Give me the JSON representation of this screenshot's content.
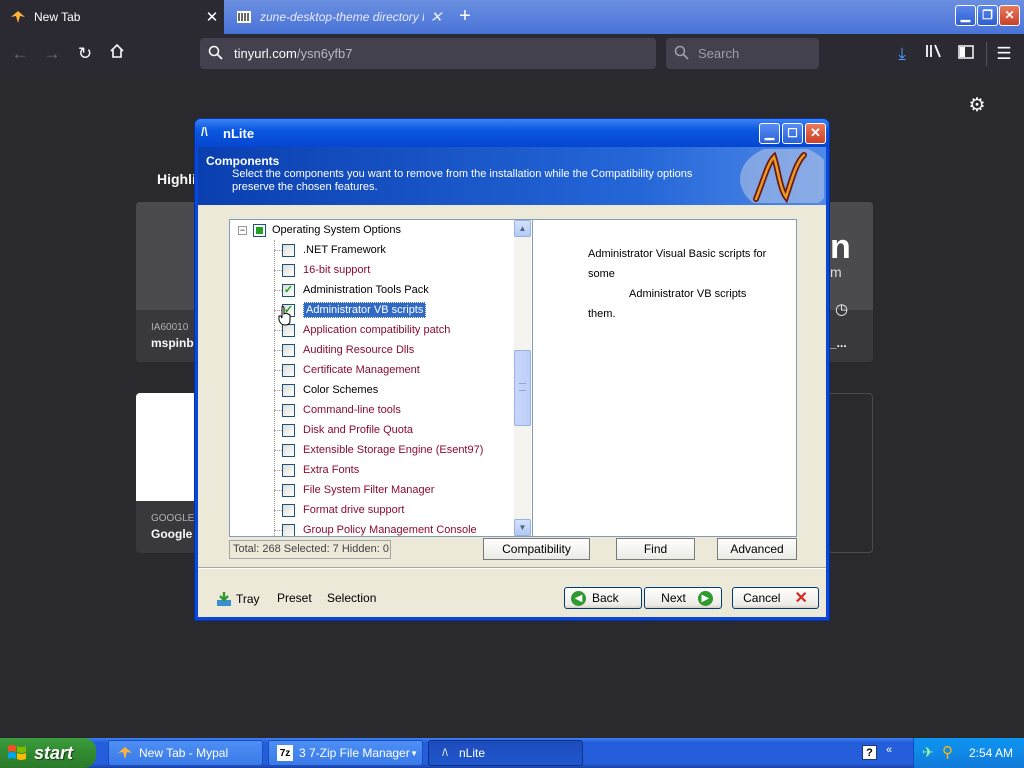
{
  "browser": {
    "tabs": [
      {
        "title": "New Tab",
        "icon": "firefox-icon",
        "active": true
      },
      {
        "title": "zune-desktop-theme directory list",
        "icon": "archive-icon",
        "active": false
      }
    ],
    "url_host": "tinyurl.com",
    "url_path": "/ysn6yfb7",
    "search_placeholder": "Search"
  },
  "newtab": {
    "highlights_label": "Highli",
    "cards": [
      {
        "host": "IA60010",
        "title": "mspinb"
      },
      {
        "host": "",
        "title": "_..."
      },
      {
        "host": "GOOGLE",
        "title": "Google"
      }
    ],
    "partial_letter": "n",
    "partial_small": "m"
  },
  "nlite": {
    "title": "nLite",
    "header_title": "Components",
    "header_desc": "Select the components you want to remove from the installation while the Compatibility options preserve the chosen features.",
    "tree_root": "Operating System Options",
    "tree_items": [
      {
        "label": ".NET Framework",
        "checked": false,
        "style": "black"
      },
      {
        "label": "16-bit support",
        "checked": false,
        "style": "red"
      },
      {
        "label": "Administration Tools Pack",
        "checked": true,
        "style": "black"
      },
      {
        "label": "Administrator VB scripts",
        "checked": true,
        "style": "selected"
      },
      {
        "label": "Application compatibility patch",
        "checked": false,
        "style": "red"
      },
      {
        "label": "Auditing Resource Dlls",
        "checked": false,
        "style": "red"
      },
      {
        "label": "Certificate Management",
        "checked": false,
        "style": "red"
      },
      {
        "label": "Color Schemes",
        "checked": false,
        "style": "black"
      },
      {
        "label": "Command-line tools",
        "checked": false,
        "style": "red"
      },
      {
        "label": "Disk and Profile Quota",
        "checked": false,
        "style": "red"
      },
      {
        "label": "Extensible Storage Engine (Esent97)",
        "checked": false,
        "style": "red"
      },
      {
        "label": "Extra Fonts",
        "checked": false,
        "style": "red"
      },
      {
        "label": "File System Filter Manager",
        "checked": false,
        "style": "red"
      },
      {
        "label": "Format drive support",
        "checked": false,
        "style": "red"
      },
      {
        "label": "Group Policy Management Console",
        "checked": false,
        "style": "red"
      }
    ],
    "description_lines": [
      "Administrator Visual Basic scripts for some",
      "Administrator VB scripts",
      "them."
    ],
    "status": "Total: 268 Selected: 7 Hidden: 0",
    "buttons": {
      "compatibility": "Compatibility",
      "find": "Find",
      "advanced": "Advanced",
      "back": "Back",
      "next": "Next",
      "cancel": "Cancel"
    },
    "footer": {
      "tray": "Tray",
      "preset": "Preset",
      "selection": "Selection"
    }
  },
  "taskbar": {
    "start": "start",
    "tasks": [
      {
        "label": "New Tab - Mypal",
        "icon": "mypal-icon"
      },
      {
        "label": "3 7-Zip File Manager",
        "icon": "7zip-icon"
      },
      {
        "label": "nLite",
        "icon": "nlite-icon"
      }
    ],
    "clock": "2:54 AM"
  },
  "colors": {
    "xp_blue": "#245edb",
    "selection": "#316ac5",
    "red_item": "#8b0b32",
    "check_green": "#21a121"
  }
}
